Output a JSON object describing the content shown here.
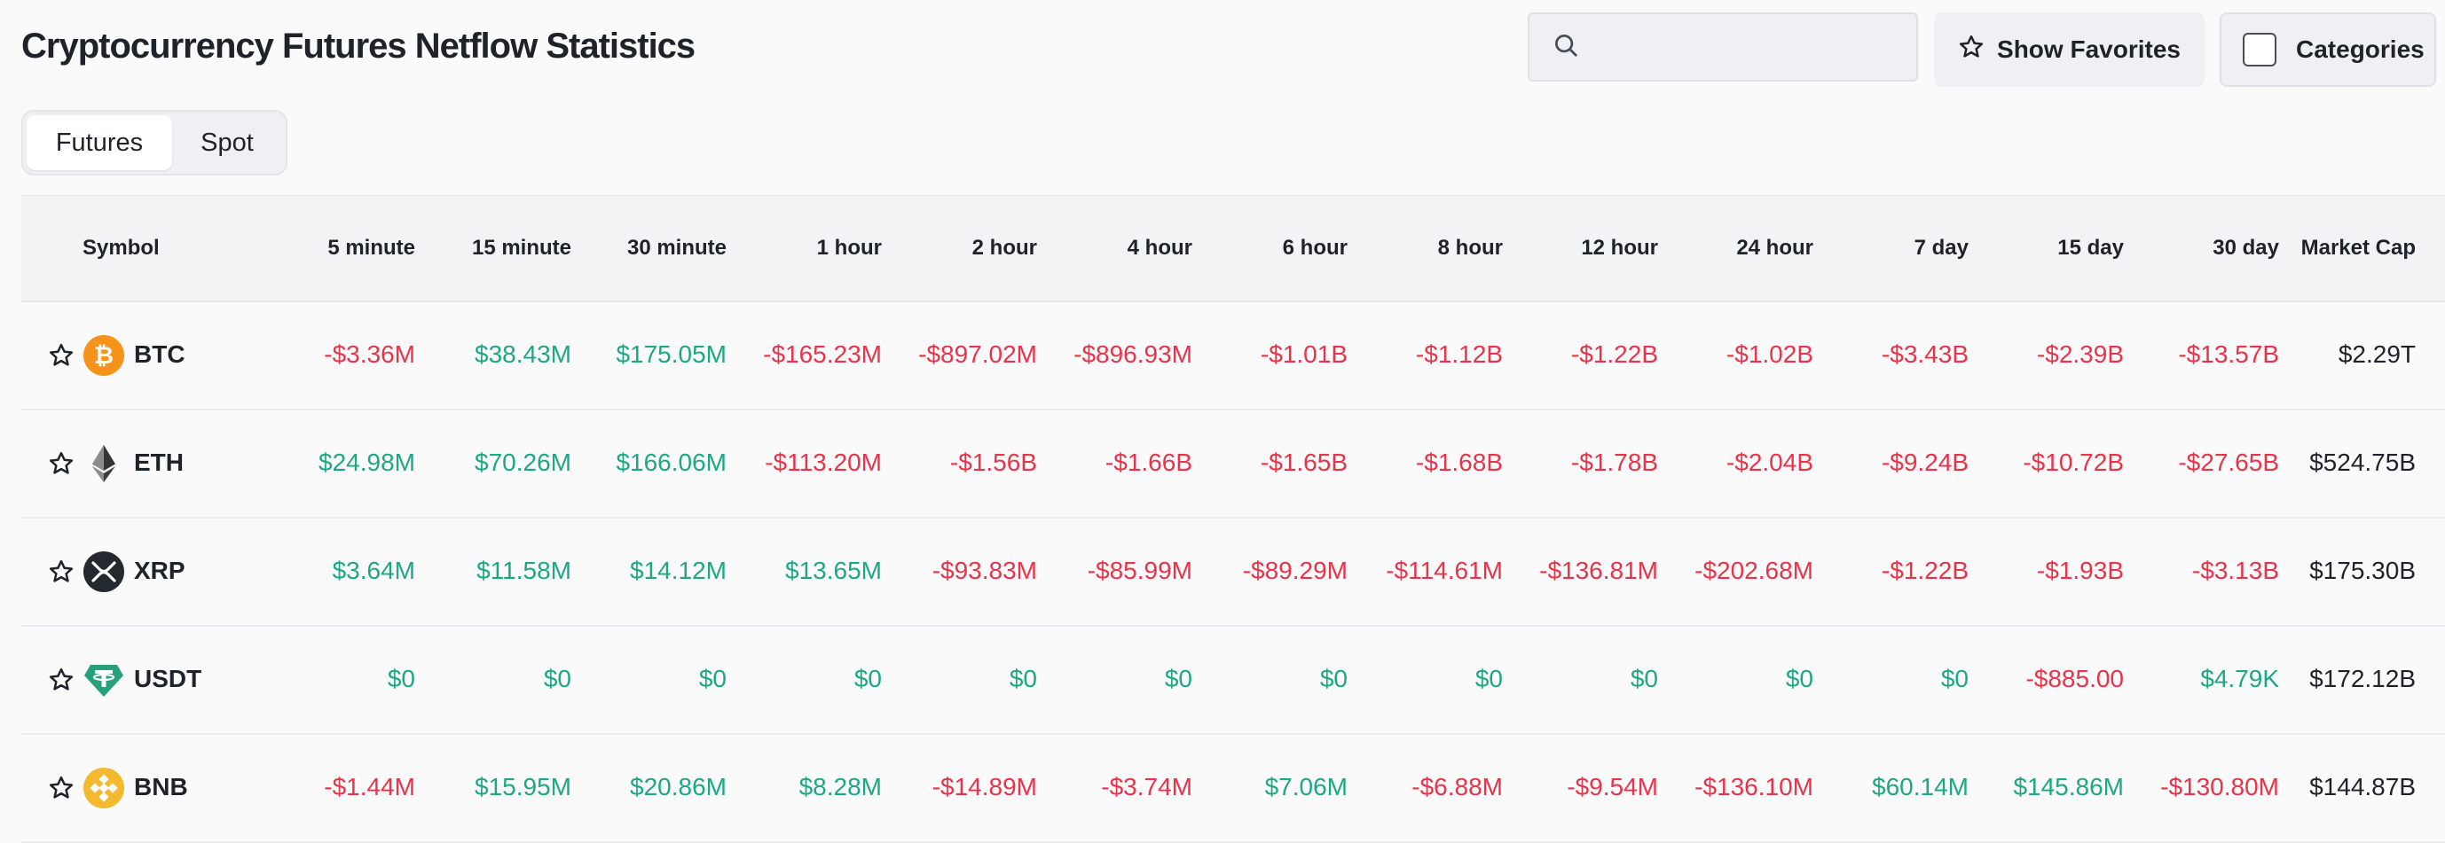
{
  "header": {
    "title": "Cryptocurrency Futures Netflow Statistics",
    "search_placeholder": "",
    "favorites_label": "Show Favorites",
    "categories_label": "Categories"
  },
  "tabs": [
    {
      "label": "Futures",
      "active": true
    },
    {
      "label": "Spot",
      "active": false
    }
  ],
  "colors": {
    "negative": "#e8334a",
    "positive": "#1ca885",
    "btc": "#f7931a",
    "xrp": "#23292f",
    "usdt": "#26a17b",
    "bnb": "#f3ba2f"
  },
  "table": {
    "columns": [
      "Symbol",
      "5 minute",
      "15 minute",
      "30 minute",
      "1 hour",
      "2 hour",
      "4 hour",
      "6 hour",
      "8 hour",
      "12 hour",
      "24 hour",
      "7 day",
      "15 day",
      "30 day",
      "Market Cap"
    ],
    "rows": [
      {
        "symbol": "BTC",
        "icon": "btc-icon",
        "values": [
          "-$3.36M",
          "$38.43M",
          "$175.05M",
          "-$165.23M",
          "-$897.02M",
          "-$896.93M",
          "-$1.01B",
          "-$1.12B",
          "-$1.22B",
          "-$1.02B",
          "-$3.43B",
          "-$2.39B",
          "-$13.57B"
        ],
        "market_cap": "$2.29T"
      },
      {
        "symbol": "ETH",
        "icon": "eth-icon",
        "values": [
          "$24.98M",
          "$70.26M",
          "$166.06M",
          "-$113.20M",
          "-$1.56B",
          "-$1.66B",
          "-$1.65B",
          "-$1.68B",
          "-$1.78B",
          "-$2.04B",
          "-$9.24B",
          "-$10.72B",
          "-$27.65B"
        ],
        "market_cap": "$524.75B"
      },
      {
        "symbol": "XRP",
        "icon": "xrp-icon",
        "values": [
          "$3.64M",
          "$11.58M",
          "$14.12M",
          "$13.65M",
          "-$93.83M",
          "-$85.99M",
          "-$89.29M",
          "-$114.61M",
          "-$136.81M",
          "-$202.68M",
          "-$1.22B",
          "-$1.93B",
          "-$3.13B"
        ],
        "market_cap": "$175.30B"
      },
      {
        "symbol": "USDT",
        "icon": "usdt-icon",
        "values": [
          "$0",
          "$0",
          "$0",
          "$0",
          "$0",
          "$0",
          "$0",
          "$0",
          "$0",
          "$0",
          "$0",
          "-$885.00",
          "$4.79K"
        ],
        "market_cap": "$172.12B"
      },
      {
        "symbol": "BNB",
        "icon": "bnb-icon",
        "values": [
          "-$1.44M",
          "$15.95M",
          "$20.86M",
          "$8.28M",
          "-$14.89M",
          "-$3.74M",
          "$7.06M",
          "-$6.88M",
          "-$9.54M",
          "-$136.10M",
          "$60.14M",
          "$145.86M",
          "-$130.80M"
        ],
        "market_cap": "$144.87B"
      }
    ]
  }
}
